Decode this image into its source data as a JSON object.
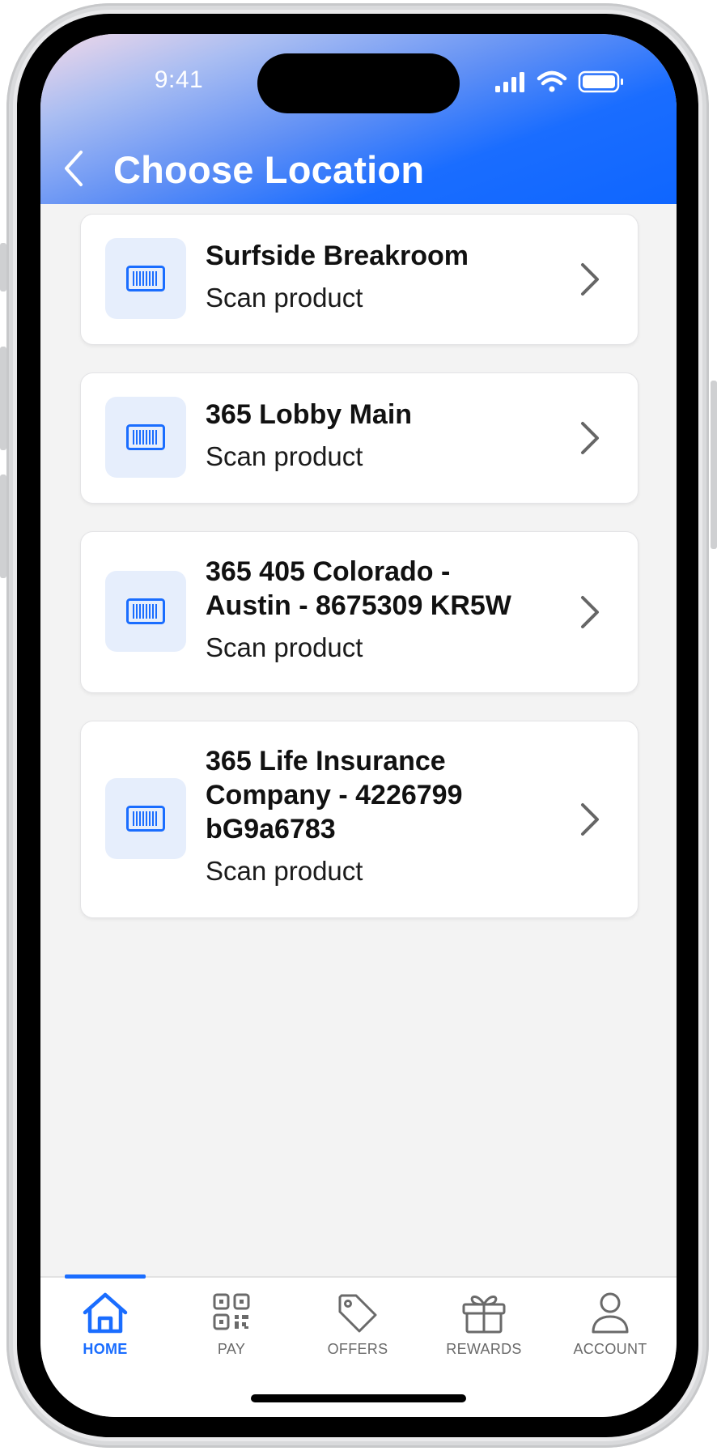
{
  "status_bar": {
    "time": "9:41"
  },
  "header": {
    "title": "Choose Location"
  },
  "locations": [
    {
      "title_lines": [
        "Surfside Breakroom"
      ],
      "subtitle": "Scan product"
    },
    {
      "title_lines": [
        "365 Lobby Main"
      ],
      "subtitle": "Scan product"
    },
    {
      "title_lines": [
        "365 405 Colorado -",
        "Austin - 8675309 KR5W"
      ],
      "subtitle": "Scan product"
    },
    {
      "title_lines": [
        "365 Life Insurance",
        "Company - 4226799",
        "bG9a6783"
      ],
      "subtitle": "Scan product"
    }
  ],
  "tabs": [
    {
      "label": "HOME",
      "icon": "home-icon",
      "active": true
    },
    {
      "label": "PAY",
      "icon": "qr-code-icon",
      "active": false
    },
    {
      "label": "OFFERS",
      "icon": "tag-icon",
      "active": false
    },
    {
      "label": "REWARDS",
      "icon": "gift-icon",
      "active": false
    },
    {
      "label": "ACCOUNT",
      "icon": "person-icon",
      "active": false
    }
  ],
  "colors": {
    "accent": "#1a6dff",
    "icon_tile": "#e6eefc",
    "background": "#f3f3f3",
    "inactive_tab": "#6a6a6a"
  }
}
